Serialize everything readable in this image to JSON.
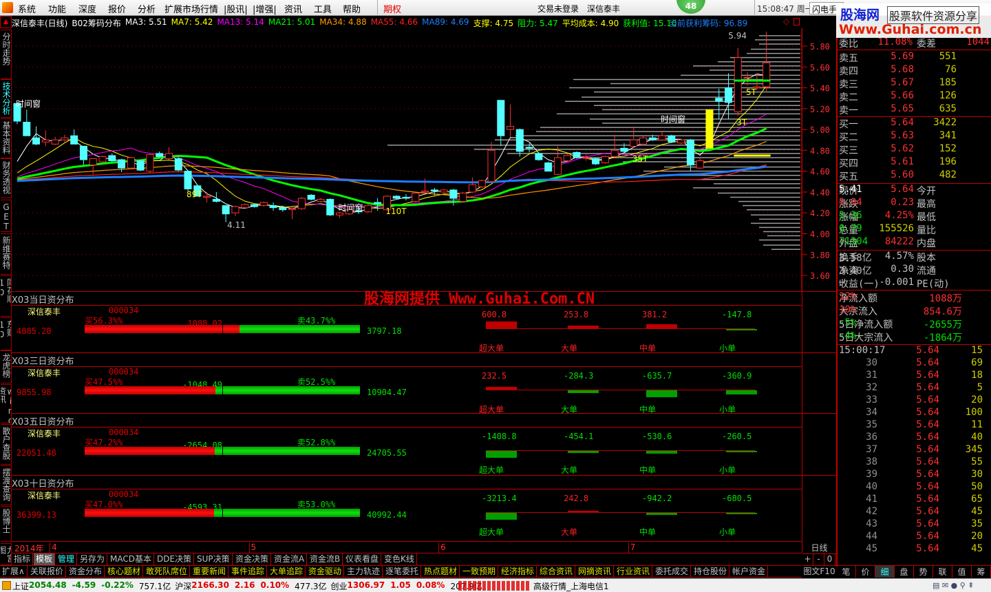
{
  "menu": {
    "items": [
      "系统",
      "功能",
      "深度",
      "报价",
      "分析",
      "扩展市场行情",
      "|股讯|",
      "|增强|",
      "资讯",
      "工具",
      "帮助"
    ],
    "options_label": "期权"
  },
  "topbar": {
    "login": "交易未登录",
    "stock": "深信泰丰",
    "badge": "48",
    "time": "15:08:47 周一",
    "flash": "闪电手"
  },
  "logo": {
    "name": "股海网",
    "slogan": "股票软件资源分享",
    "url": "Www.Guhai.com.cn"
  },
  "watermark": "股海网提供 Www.Guhai.Com.CN",
  "info": {
    "title": "深信泰丰(日线)",
    "indicator": "B02筹码分布",
    "ma": [
      {
        "label": "MA3: 5.51",
        "color": "#ffffff"
      },
      {
        "label": "MA7: 5.42",
        "color": "#ffff00"
      },
      {
        "label": "MA13: 5.14",
        "color": "#ff00ff"
      },
      {
        "label": "MA21: 5.01",
        "color": "#00ff00"
      },
      {
        "label": "MA34: 4.88",
        "color": "#ff9900"
      },
      {
        "label": "MA55: 4.66",
        "color": "#ff2020"
      },
      {
        "label": "MA89: 4.69",
        "color": "#1e7fff"
      }
    ],
    "support": "支撑: 4.75",
    "resistance": "阻力: 5.47",
    "avg_cost": "平均成本: 4.90",
    "profit_value": "获利值: 15.10",
    "profit_chips": "当前获利筹码: 96.89"
  },
  "sidebar": [
    {
      "label": "分时走势"
    },
    {
      "label": "技术分析",
      "active": true
    },
    {
      "label": "基本资料"
    },
    {
      "label": "财务透视"
    },
    {
      "label": "GET"
    },
    {
      "label": "新维赛特"
    },
    {
      "label": "同花顺10"
    },
    {
      "label": "东财10"
    },
    {
      "label": "龙虎榜"
    },
    {
      "label": "wind资讯"
    },
    {
      "label": "散户查股"
    },
    {
      "label": "摆渡查询"
    },
    {
      "label": "股博士"
    },
    {
      "label": "九宫图"
    }
  ],
  "chart_data": {
    "type": "candlestick",
    "y_ticks": [
      "5.80",
      "5.60",
      "5.40",
      "5.20",
      "5.00",
      "4.80",
      "4.60",
      "4.40",
      "4.20",
      "4.00",
      "3.80",
      "3.60"
    ],
    "support": 4.75,
    "resistance": 5.47,
    "candles": [
      [
        5.25,
        5.26,
        5.05,
        5.08
      ],
      [
        5.07,
        5.19,
        4.94,
        4.94
      ],
      [
        4.92,
        5.03,
        4.85,
        4.86
      ],
      [
        4.88,
        4.99,
        4.84,
        4.9
      ],
      [
        4.86,
        4.93,
        4.85,
        4.9
      ],
      [
        4.9,
        4.95,
        4.88,
        4.92
      ],
      [
        4.94,
        5.0,
        4.86,
        4.86
      ],
      [
        4.84,
        4.84,
        4.66,
        4.71
      ],
      [
        4.66,
        4.72,
        4.57,
        4.72
      ],
      [
        4.69,
        4.75,
        4.68,
        4.74
      ],
      [
        4.75,
        4.77,
        4.69,
        4.7
      ],
      [
        4.71,
        4.72,
        4.59,
        4.63
      ],
      [
        4.63,
        4.74,
        4.62,
        4.73
      ],
      [
        4.7,
        4.71,
        4.6,
        4.61
      ],
      [
        4.6,
        4.77,
        4.58,
        4.76
      ],
      [
        4.77,
        4.79,
        4.73,
        4.74
      ],
      [
        4.72,
        4.83,
        4.71,
        4.77
      ],
      [
        4.72,
        4.73,
        4.6,
        4.61
      ],
      [
        4.6,
        4.61,
        4.41,
        4.43
      ],
      [
        4.46,
        4.47,
        4.36,
        4.36
      ],
      [
        4.35,
        4.4,
        4.3,
        4.36
      ],
      [
        4.33,
        4.4,
        4.3,
        4.31
      ],
      [
        4.27,
        4.27,
        4.11,
        4.19
      ],
      [
        4.2,
        4.27,
        4.17,
        4.26
      ],
      [
        4.25,
        4.29,
        4.24,
        4.28
      ],
      [
        4.28,
        4.29,
        4.25,
        4.26
      ],
      [
        4.27,
        4.31,
        4.26,
        4.3
      ],
      [
        4.27,
        4.3,
        4.22,
        4.25
      ],
      [
        4.25,
        4.27,
        4.21,
        4.23
      ],
      [
        4.23,
        4.27,
        4.14,
        4.24
      ],
      [
        4.24,
        4.35,
        4.23,
        4.34
      ],
      [
        4.37,
        4.38,
        4.32,
        4.33
      ],
      [
        4.31,
        4.34,
        4.3,
        4.33
      ],
      [
        4.33,
        4.34,
        4.17,
        4.18
      ],
      [
        4.18,
        4.21,
        4.15,
        4.2
      ],
      [
        4.19,
        4.24,
        4.18,
        4.23
      ],
      [
        4.22,
        4.26,
        4.19,
        4.21
      ],
      [
        4.21,
        4.28,
        4.2,
        4.27
      ],
      [
        4.3,
        4.34,
        4.22,
        4.29
      ],
      [
        4.23,
        4.37,
        4.22,
        4.36
      ],
      [
        4.36,
        4.37,
        4.33,
        4.34
      ],
      [
        4.35,
        4.38,
        4.32,
        4.34
      ],
      [
        4.31,
        4.4,
        4.3,
        4.39
      ],
      [
        4.4,
        4.53,
        4.39,
        4.41
      ],
      [
        4.42,
        4.44,
        4.37,
        4.41
      ],
      [
        4.4,
        4.43,
        4.39,
        4.42
      ],
      [
        4.42,
        4.43,
        4.27,
        4.34
      ],
      [
        4.31,
        4.4,
        4.3,
        4.39
      ],
      [
        4.4,
        4.54,
        4.39,
        4.47
      ],
      [
        4.45,
        4.52,
        4.44,
        4.51
      ],
      [
        4.5,
        4.88,
        4.49,
        4.8
      ],
      [
        5.28,
        5.28,
        4.84,
        4.94
      ],
      [
        5.0,
        5.24,
        4.93,
        5.03
      ],
      [
        5.0,
        5.01,
        4.74,
        4.79
      ],
      [
        4.83,
        4.87,
        4.78,
        4.82
      ],
      [
        4.77,
        4.78,
        4.7,
        4.71
      ],
      [
        4.68,
        4.69,
        4.6,
        4.6
      ],
      [
        4.57,
        4.84,
        4.56,
        4.73
      ],
      [
        4.7,
        4.76,
        4.69,
        4.75
      ],
      [
        4.78,
        4.79,
        4.72,
        4.73
      ],
      [
        4.73,
        4.76,
        4.7,
        4.73
      ],
      [
        4.72,
        4.73,
        4.66,
        4.67
      ],
      [
        4.68,
        4.75,
        4.67,
        4.74
      ],
      [
        4.74,
        4.95,
        4.73,
        4.8
      ],
      [
        4.82,
        4.87,
        4.78,
        4.79
      ],
      [
        4.84,
        5.03,
        4.83,
        4.9
      ],
      [
        4.86,
        4.94,
        4.85,
        4.92
      ],
      [
        4.92,
        4.95,
        4.89,
        4.9
      ],
      [
        4.9,
        4.99,
        4.89,
        4.94
      ],
      [
        4.94,
        4.95,
        4.87,
        4.88
      ],
      [
        4.87,
        4.91,
        4.86,
        4.9
      ],
      [
        4.9,
        4.91,
        4.6,
        4.66
      ],
      [
        4.63,
        4.73,
        4.62,
        4.7
      ],
      [
        4.82,
        5.19,
        4.82,
        5.19
      ],
      [
        5.3,
        5.39,
        5.1,
        5.27
      ],
      [
        5.4,
        5.54,
        5.1,
        5.26
      ],
      [
        5.17,
        5.78,
        5.13,
        5.69
      ],
      [
        5.5,
        5.55,
        5.42,
        5.5
      ],
      [
        5.4,
        5.54,
        5.38,
        5.41
      ],
      [
        5.41,
        5.94,
        5.36,
        5.64
      ]
    ],
    "limit_up_index": 73,
    "ma_periods": [
      3,
      7,
      13,
      21,
      34,
      55,
      89
    ],
    "chip_prices": [
      5.9,
      5.86,
      5.82,
      5.77,
      5.73,
      5.69,
      5.65,
      5.61,
      5.57,
      5.52,
      5.48,
      5.44,
      5.4,
      5.36,
      5.31,
      5.27,
      5.23,
      5.19,
      5.15,
      5.1,
      5.06,
      5.02,
      4.98,
      4.94,
      4.9,
      4.85,
      4.81,
      4.77,
      4.73,
      4.69,
      4.64,
      4.6,
      4.56,
      4.52,
      4.48,
      4.44,
      4.39,
      4.35,
      4.31,
      4.27,
      4.23,
      4.18,
      4.14,
      4.1,
      4.06,
      4.02,
      3.98,
      3.94,
      3.89,
      3.85
    ],
    "chip_volumes": [
      0.1,
      0.11,
      0.1,
      0.12,
      0.13,
      0.17,
      0.2,
      0.26,
      0.22,
      0.29,
      0.55,
      0.46,
      0.56,
      0.5,
      0.53,
      0.57,
      0.5,
      0.48,
      0.59,
      0.51,
      0.48,
      0.63,
      0.64,
      0.69,
      0.74,
      1.0,
      0.79,
      0.71,
      0.54,
      0.43,
      0.33,
      0.38,
      0.31,
      0.25,
      0.21,
      0.26,
      0.2,
      0.17,
      0.15,
      0.14,
      0.13,
      0.12,
      0.1,
      0.12,
      0.1,
      0.09,
      0.08,
      0.1,
      0.09,
      0.07
    ],
    "annotations": [
      {
        "text": "时间窗",
        "index": 0,
        "price": 5.22,
        "color": "#ffffff"
      },
      {
        "text": "时间窗",
        "index": 34,
        "price": 4.22,
        "color": "#ffffff"
      },
      {
        "text": "时间窗",
        "index": 68,
        "price": 5.07,
        "color": "#ffffff"
      },
      {
        "text": "89T",
        "index": 18,
        "price": 4.35,
        "color": "#ffff00"
      },
      {
        "text": "110T",
        "index": 39,
        "price": 4.19,
        "color": "#ffff00"
      },
      {
        "text": "35T",
        "index": 65,
        "price": 4.69,
        "color": "#ffff00"
      },
      {
        "text": "3T",
        "index": 76,
        "price": 5.04,
        "color": "#ffff00"
      },
      {
        "text": "5T",
        "index": 77,
        "price": 5.33,
        "color": "#ffff00"
      }
    ],
    "low_label": "4.11",
    "high_label": "5.94",
    "date_axis": [
      {
        "label": "2014年",
        "index": 0
      },
      {
        "label": "4",
        "index": 4
      },
      {
        "label": "5",
        "index": 25
      },
      {
        "label": "6",
        "index": 45
      },
      {
        "label": "7",
        "index": 65
      }
    ],
    "period": "日线"
  },
  "flow_panels": [
    {
      "title": "X03当日资分布",
      "name": "深信泰丰",
      "code": "000034",
      "buy_label": "买56.3%%",
      "sell_label": "卖43.7%%",
      "buy_pct": 56.3,
      "net": "1088.02",
      "buy_total": "4885.20",
      "sell_total": "3797.18",
      "orders": [
        {
          "label": "超大单",
          "value": "600.8"
        },
        {
          "label": "大单",
          "value": "253.8"
        },
        {
          "label": "中单",
          "value": "381.2"
        },
        {
          "label": "小单",
          "value": "-147.8"
        }
      ]
    },
    {
      "title": "X03三日资分布",
      "name": "深信泰丰",
      "code": "000034",
      "buy_label": "买47.5%%",
      "sell_label": "卖52.5%%",
      "buy_pct": 47.5,
      "net": "-1048.49",
      "buy_total": "9855.98",
      "sell_total": "10904.47",
      "orders": [
        {
          "label": "超大单",
          "value": "232.5"
        },
        {
          "label": "大单",
          "value": "-284.3"
        },
        {
          "label": "中单",
          "value": "-635.7"
        },
        {
          "label": "小单",
          "value": "-360.9"
        }
      ]
    },
    {
      "title": "X03五日资分布",
      "name": "深信泰丰",
      "code": "000034",
      "buy_label": "买47.2%%",
      "sell_label": "卖52.8%%",
      "buy_pct": 47.2,
      "net": "-2654.08",
      "buy_total": "22051.48",
      "sell_total": "24705.55",
      "orders": [
        {
          "label": "超大单",
          "value": "-1408.8"
        },
        {
          "label": "大单",
          "value": "-454.1"
        },
        {
          "label": "中单",
          "value": "-530.6"
        },
        {
          "label": "小单",
          "value": "-260.5"
        }
      ]
    },
    {
      "title": "X03十日资分布",
      "name": "深信泰丰",
      "code": "000034",
      "buy_label": "买47.0%%",
      "sell_label": "卖53.0%%",
      "buy_pct": 47.0,
      "net": "-4593.31",
      "buy_total": "36399.13",
      "sell_total": "40992.44",
      "orders": [
        {
          "label": "超大单",
          "value": "-3213.4"
        },
        {
          "label": "大单",
          "value": "242.8"
        },
        {
          "label": "中单",
          "value": "-942.2"
        },
        {
          "label": "小单",
          "value": "-680.5"
        }
      ]
    }
  ],
  "toolbar1": [
    "指标",
    "模板",
    "管理",
    "另存为",
    "MACD基本",
    "DDE决策",
    "SUP决策",
    "资金决策",
    "资金流A",
    "资金流B",
    "仪表看盘",
    "变色K线"
  ],
  "toolbar2": [
    {
      "label": "扩展∧"
    },
    {
      "label": "关联报价"
    },
    {
      "label": "资金分布"
    },
    {
      "label": "核心题材",
      "y": true
    },
    {
      "label": "敢死队席位",
      "y": true
    },
    {
      "label": "重要新闻",
      "y": true
    },
    {
      "label": "事件追踪",
      "y": true
    },
    {
      "label": "大单追踪",
      "y": true
    },
    {
      "label": "资金驱动",
      "y": true
    },
    {
      "label": "主力轨迹"
    },
    {
      "label": "逐笔委托"
    },
    {
      "label": "热点题材",
      "y": true
    },
    {
      "label": "一致预期",
      "y": true
    },
    {
      "label": "经济指标",
      "y": true
    },
    {
      "label": "综合资讯",
      "y": true
    },
    {
      "label": "网摘资讯",
      "y": true
    },
    {
      "label": "行业资讯",
      "y": true
    },
    {
      "label": "委托成交"
    },
    {
      "label": "持仓股份"
    },
    {
      "label": "帐户资金"
    }
  ],
  "zoom_buttons": [
    "+",
    "-",
    "0"
  ],
  "f10_label": "图文F10",
  "right_tabs": [
    "笔",
    "价",
    "细",
    "盘",
    "势",
    "联",
    "值",
    "筹"
  ],
  "right_active_tab": "细",
  "quote": {
    "weibi": {
      "l1": "委比",
      "v1": "11.08%",
      "l2": "委差",
      "v2": "1044"
    },
    "asks": [
      {
        "label": "卖五",
        "price": "5.69",
        "vol": "551"
      },
      {
        "label": "卖四",
        "price": "5.68",
        "vol": "76"
      },
      {
        "label": "卖三",
        "price": "5.67",
        "vol": "185"
      },
      {
        "label": "卖二",
        "price": "5.66",
        "vol": "126"
      },
      {
        "label": "卖一",
        "price": "5.65",
        "vol": "635"
      }
    ],
    "bids": [
      {
        "label": "买一",
        "price": "5.64",
        "vol": "3422"
      },
      {
        "label": "买二",
        "price": "5.63",
        "vol": "341"
      },
      {
        "label": "买三",
        "price": "5.62",
        "vol": "152"
      },
      {
        "label": "买四",
        "price": "5.61",
        "vol": "196"
      },
      {
        "label": "买五",
        "price": "5.60",
        "vol": "482"
      }
    ],
    "stats": [
      {
        "l1": "现价",
        "v1": "5.64",
        "c1": "#ff3030",
        "l2": "今开",
        "v2": "5.41",
        "c2": "#ffffff"
      },
      {
        "l1": "涨跌",
        "v1": "0.23",
        "c1": "#ff3030",
        "l2": "最高",
        "v2": "5.94",
        "c2": "#ff3030"
      },
      {
        "l1": "涨幅",
        "v1": "4.25%",
        "c1": "#ff3030",
        "l2": "最低",
        "v2": "5.36",
        "c2": "#00e000"
      },
      {
        "l1": "总量",
        "v1": "155526",
        "c1": "#d0d000",
        "l2": "量比",
        "v2": "0.79",
        "c2": "#00e000"
      },
      {
        "l1": "外盘",
        "v1": "84222",
        "c1": "#ff3030",
        "l2": "内盘",
        "v2": "71304",
        "c2": "#00e000"
      }
    ],
    "basics": [
      {
        "l1": "换手",
        "v1": "4.57%",
        "l2": "股本",
        "v2": "3.58亿"
      },
      {
        "l1": "净资",
        "v1": "0.30",
        "l2": "流通",
        "v2": "3.40亿"
      },
      {
        "l1": "收益(一)",
        "v1": "-0.001",
        "l2": "PE(动)",
        "v2": "—"
      }
    ],
    "flows": [
      {
        "label": "净流入额",
        "value": "1088万",
        "pct": "12%",
        "color": "#ff3030"
      },
      {
        "label": "大宗流入",
        "value": "854.6万",
        "pct": "10%",
        "color": "#ff3030"
      },
      {
        "label": "5日净流入额",
        "value": "-2655万",
        "pct": "-5%",
        "color": "#00e000"
      },
      {
        "label": "5日大宗流入",
        "value": "-1864万",
        "pct": "-4%",
        "color": "#00e000"
      }
    ],
    "ticks": [
      {
        "t": "15:00:17",
        "p": "5.64",
        "v": "15"
      },
      {
        "t": "30",
        "p": "5.64",
        "v": "69"
      },
      {
        "t": "31",
        "p": "5.64",
        "v": "18"
      },
      {
        "t": "32",
        "p": "5.64",
        "v": "5"
      },
      {
        "t": "33",
        "p": "5.64",
        "v": "20"
      },
      {
        "t": "34",
        "p": "5.64",
        "v": "100"
      },
      {
        "t": "35",
        "p": "5.64",
        "v": "11"
      },
      {
        "t": "36",
        "p": "5.64",
        "v": "40"
      },
      {
        "t": "37",
        "p": "5.64",
        "v": "345"
      },
      {
        "t": "38",
        "p": "5.64",
        "v": "55"
      },
      {
        "t": "39",
        "p": "5.64",
        "v": "30"
      },
      {
        "t": "40",
        "p": "5.64",
        "v": "50"
      },
      {
        "t": "41",
        "p": "5.64",
        "v": "65"
      },
      {
        "t": "42",
        "p": "5.64",
        "v": "45"
      },
      {
        "t": "43",
        "p": "5.64",
        "v": "35"
      },
      {
        "t": "44",
        "p": "5.64",
        "v": "20"
      },
      {
        "t": "45",
        "p": "5.64",
        "v": "45"
      }
    ]
  },
  "status": {
    "indices": [
      {
        "name": "上证",
        "value": "2054.48",
        "change": "-4.59",
        "pct": "-0.22%",
        "amount": "757.1亿",
        "color": "#008000"
      },
      {
        "name": "沪深",
        "value": "2166.30",
        "change": "2.16",
        "pct": "0.10%",
        "amount": "477.3亿",
        "color": "#e00000"
      },
      {
        "name": "创业",
        "value": "1306.97",
        "change": "1.05",
        "pct": "0.08%",
        "amount": "207.9亿",
        "color": "#e00000"
      }
    ],
    "server": "高级行情_上海电信1"
  }
}
